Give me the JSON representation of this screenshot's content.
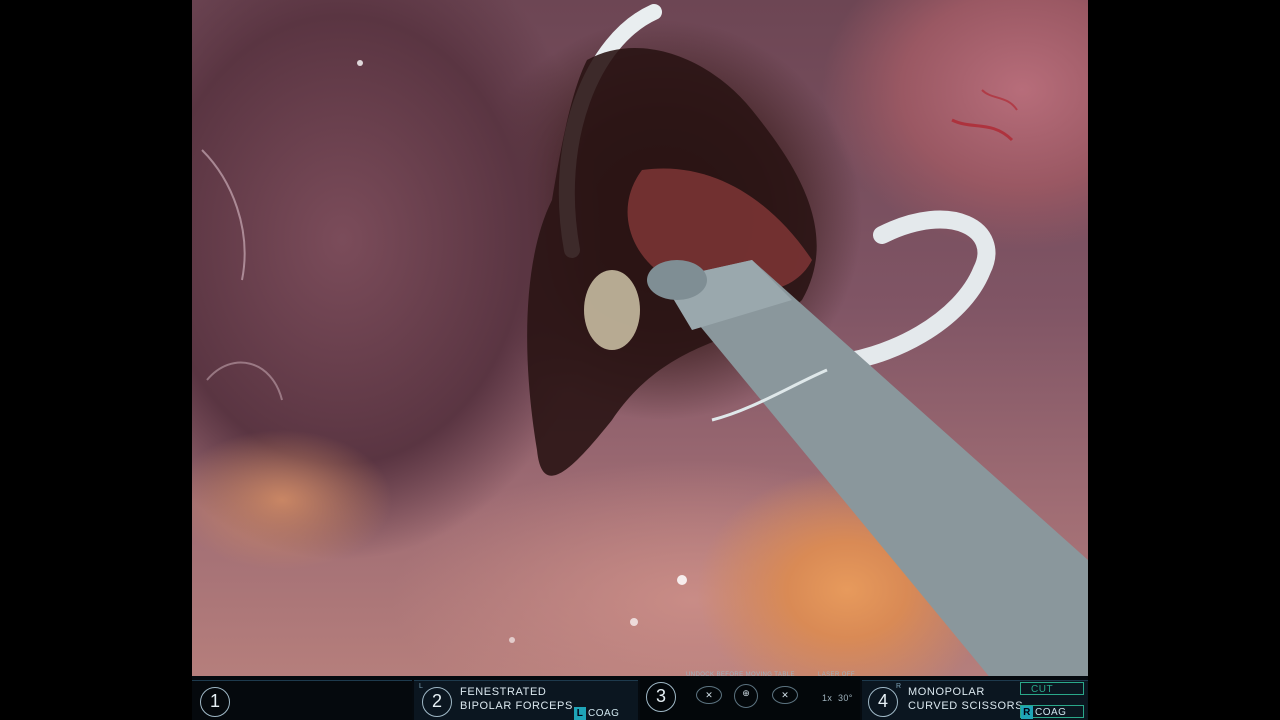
{
  "hud": {
    "arm1": {
      "number": "1"
    },
    "arm2": {
      "number": "2",
      "corner": "L",
      "line1": "FENESTRATED",
      "line2": "BIPOLAR FORCEPS",
      "mode_letter": "L",
      "mode": "COAG"
    },
    "center": {
      "number": "3",
      "notice": "UNDOCK BEFORE MOVING TABLE",
      "laser": "LASER OFF",
      "zoom": "1x",
      "angle": "30°"
    },
    "arm4": {
      "number": "4",
      "corner": "R",
      "line1": "MONOPOLAR",
      "line2": "CURVED SCISSORS",
      "cut": "CUT",
      "mode_letter": "R",
      "mode": "COAG"
    }
  },
  "colors": {
    "accent": "#1fa5b8",
    "panel": "#0b1620",
    "cut_box": "#2aa88a"
  }
}
